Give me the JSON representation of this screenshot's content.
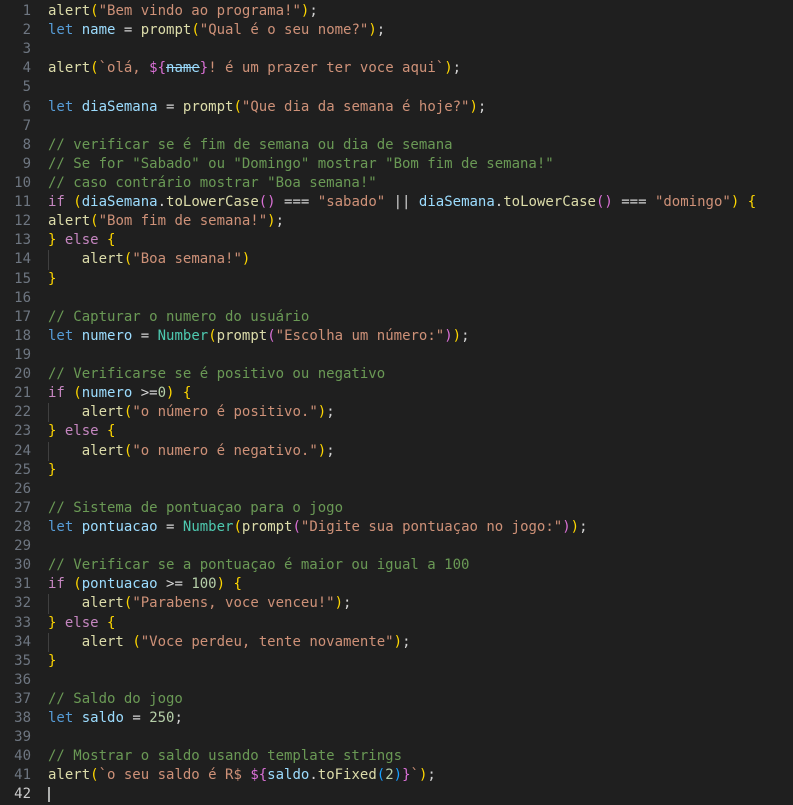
{
  "editor": {
    "background": "#1f1f1f",
    "gutter_color": "#6e7681",
    "active_gutter_color": "#cccccc",
    "indent_guide_color": "#404040",
    "cursor_color": "#aeafad",
    "active_line": 42,
    "palette": {
      "fn": "#DCDCAA",
      "kw": "#569CD6",
      "ctrl": "#C586C0",
      "var": "#9CDCFE",
      "cls": "#4EC9B0",
      "str": "#CE9178",
      "com": "#6A9955",
      "num": "#B5CEA8",
      "op": "#D4D4D4",
      "b1": "#FFD700",
      "b2": "#DA70D6",
      "b3": "#179FFF"
    },
    "lines": [
      {
        "n": 1,
        "tokens": [
          {
            "t": "alert",
            "c": "fn"
          },
          {
            "t": "(",
            "c": "b1"
          },
          {
            "t": "\"Bem vindo ao programa!\"",
            "c": "str"
          },
          {
            "t": ")",
            "c": "b1"
          },
          {
            "t": ";",
            "c": "op"
          }
        ]
      },
      {
        "n": 2,
        "tokens": [
          {
            "t": "let",
            "c": "kw"
          },
          {
            "t": " ",
            "c": "op"
          },
          {
            "t": "name",
            "c": "var"
          },
          {
            "t": " = ",
            "c": "op"
          },
          {
            "t": "prompt",
            "c": "fn"
          },
          {
            "t": "(",
            "c": "b1"
          },
          {
            "t": "\"Qual é o seu nome?\"",
            "c": "str"
          },
          {
            "t": ")",
            "c": "b1"
          },
          {
            "t": ";",
            "c": "op"
          }
        ]
      },
      {
        "n": 3,
        "tokens": []
      },
      {
        "n": 4,
        "tokens": [
          {
            "t": "alert",
            "c": "fn"
          },
          {
            "t": "(",
            "c": "b1"
          },
          {
            "t": "`olá, ",
            "c": "str"
          },
          {
            "t": "${",
            "c": "b2"
          },
          {
            "t": "name",
            "c": "var",
            "s": 1
          },
          {
            "t": "}",
            "c": "b2"
          },
          {
            "t": "! é um prazer ter voce aqui`",
            "c": "str"
          },
          {
            "t": ")",
            "c": "b1"
          },
          {
            "t": ";",
            "c": "op"
          }
        ]
      },
      {
        "n": 5,
        "tokens": []
      },
      {
        "n": 6,
        "tokens": [
          {
            "t": "let",
            "c": "kw"
          },
          {
            "t": " ",
            "c": "op"
          },
          {
            "t": "diaSemana",
            "c": "var"
          },
          {
            "t": " = ",
            "c": "op"
          },
          {
            "t": "prompt",
            "c": "fn"
          },
          {
            "t": "(",
            "c": "b1"
          },
          {
            "t": "\"Que dia da semana é hoje?\"",
            "c": "str"
          },
          {
            "t": ")",
            "c": "b1"
          },
          {
            "t": ";",
            "c": "op"
          }
        ]
      },
      {
        "n": 7,
        "tokens": []
      },
      {
        "n": 8,
        "tokens": [
          {
            "t": "// verificar se é fim de semana ou dia de semana",
            "c": "com"
          }
        ]
      },
      {
        "n": 9,
        "tokens": [
          {
            "t": "// Se for \"Sabado\" ou \"Domingo\" mostrar \"Bom fim de semana!\"",
            "c": "com"
          }
        ]
      },
      {
        "n": 10,
        "tokens": [
          {
            "t": "// caso contrário mostrar \"Boa semana!\"",
            "c": "com"
          }
        ]
      },
      {
        "n": 11,
        "tokens": [
          {
            "t": "if",
            "c": "ctrl"
          },
          {
            "t": " ",
            "c": "op"
          },
          {
            "t": "(",
            "c": "b1"
          },
          {
            "t": "diaSemana",
            "c": "var"
          },
          {
            "t": ".",
            "c": "op"
          },
          {
            "t": "toLowerCase",
            "c": "fn"
          },
          {
            "t": "()",
            "c": "b2"
          },
          {
            "t": " === ",
            "c": "op"
          },
          {
            "t": "\"sabado\"",
            "c": "str"
          },
          {
            "t": " || ",
            "c": "op"
          },
          {
            "t": "diaSemana",
            "c": "var"
          },
          {
            "t": ".",
            "c": "op"
          },
          {
            "t": "toLowerCase",
            "c": "fn"
          },
          {
            "t": "()",
            "c": "b2"
          },
          {
            "t": " === ",
            "c": "op"
          },
          {
            "t": "\"domingo\"",
            "c": "str"
          },
          {
            "t": ")",
            "c": "b1"
          },
          {
            "t": " ",
            "c": "op"
          },
          {
            "t": "{",
            "c": "b1"
          }
        ]
      },
      {
        "n": 12,
        "tokens": [
          {
            "t": "alert",
            "c": "fn"
          },
          {
            "t": "(",
            "c": "b1"
          },
          {
            "t": "\"Bom fim de semana!\"",
            "c": "str"
          },
          {
            "t": ")",
            "c": "b1"
          },
          {
            "t": ";",
            "c": "op"
          }
        ]
      },
      {
        "n": 13,
        "tokens": [
          {
            "t": "}",
            "c": "b1"
          },
          {
            "t": " ",
            "c": "op"
          },
          {
            "t": "else",
            "c": "ctrl"
          },
          {
            "t": " ",
            "c": "op"
          },
          {
            "t": "{",
            "c": "b1"
          }
        ]
      },
      {
        "n": 14,
        "g": 1,
        "tokens": [
          {
            "t": "    ",
            "c": "op"
          },
          {
            "t": "alert",
            "c": "fn"
          },
          {
            "t": "(",
            "c": "b1"
          },
          {
            "t": "\"Boa semana!\"",
            "c": "str"
          },
          {
            "t": ")",
            "c": "b1"
          }
        ]
      },
      {
        "n": 15,
        "tokens": [
          {
            "t": "}",
            "c": "b1"
          }
        ]
      },
      {
        "n": 16,
        "tokens": []
      },
      {
        "n": 17,
        "tokens": [
          {
            "t": "// Capturar o numero do usuário",
            "c": "com"
          }
        ]
      },
      {
        "n": 18,
        "tokens": [
          {
            "t": "let",
            "c": "kw"
          },
          {
            "t": " ",
            "c": "op"
          },
          {
            "t": "numero",
            "c": "var"
          },
          {
            "t": " = ",
            "c": "op"
          },
          {
            "t": "Number",
            "c": "cls"
          },
          {
            "t": "(",
            "c": "b1"
          },
          {
            "t": "prompt",
            "c": "fn"
          },
          {
            "t": "(",
            "c": "b2"
          },
          {
            "t": "\"Escolha um número:\"",
            "c": "str"
          },
          {
            "t": ")",
            "c": "b2"
          },
          {
            "t": ")",
            "c": "b1"
          },
          {
            "t": ";",
            "c": "op"
          }
        ]
      },
      {
        "n": 19,
        "tokens": []
      },
      {
        "n": 20,
        "tokens": [
          {
            "t": "// Verificarse se é positivo ou negativo",
            "c": "com"
          }
        ]
      },
      {
        "n": 21,
        "tokens": [
          {
            "t": "if",
            "c": "ctrl"
          },
          {
            "t": " ",
            "c": "op"
          },
          {
            "t": "(",
            "c": "b1"
          },
          {
            "t": "numero",
            "c": "var"
          },
          {
            "t": " >=",
            "c": "op"
          },
          {
            "t": "0",
            "c": "num"
          },
          {
            "t": ")",
            "c": "b1"
          },
          {
            "t": " ",
            "c": "op"
          },
          {
            "t": "{",
            "c": "b1"
          }
        ]
      },
      {
        "n": 22,
        "g": 1,
        "tokens": [
          {
            "t": "    ",
            "c": "op"
          },
          {
            "t": "alert",
            "c": "fn"
          },
          {
            "t": "(",
            "c": "b1"
          },
          {
            "t": "\"o número é positivo.\"",
            "c": "str"
          },
          {
            "t": ")",
            "c": "b1"
          },
          {
            "t": ";",
            "c": "op"
          }
        ]
      },
      {
        "n": 23,
        "tokens": [
          {
            "t": "}",
            "c": "b1"
          },
          {
            "t": " ",
            "c": "op"
          },
          {
            "t": "else",
            "c": "ctrl"
          },
          {
            "t": " ",
            "c": "op"
          },
          {
            "t": "{",
            "c": "b1"
          }
        ]
      },
      {
        "n": 24,
        "g": 1,
        "tokens": [
          {
            "t": "    ",
            "c": "op"
          },
          {
            "t": "alert",
            "c": "fn"
          },
          {
            "t": "(",
            "c": "b1"
          },
          {
            "t": "\"o numero é negativo.\"",
            "c": "str"
          },
          {
            "t": ")",
            "c": "b1"
          },
          {
            "t": ";",
            "c": "op"
          }
        ]
      },
      {
        "n": 25,
        "tokens": [
          {
            "t": "}",
            "c": "b1"
          }
        ]
      },
      {
        "n": 26,
        "tokens": []
      },
      {
        "n": 27,
        "tokens": [
          {
            "t": "// Sistema de pontuaçao para o jogo",
            "c": "com"
          }
        ]
      },
      {
        "n": 28,
        "tokens": [
          {
            "t": "let",
            "c": "kw"
          },
          {
            "t": " ",
            "c": "op"
          },
          {
            "t": "pontuacao",
            "c": "var"
          },
          {
            "t": " = ",
            "c": "op"
          },
          {
            "t": "Number",
            "c": "cls"
          },
          {
            "t": "(",
            "c": "b1"
          },
          {
            "t": "prompt",
            "c": "fn"
          },
          {
            "t": "(",
            "c": "b2"
          },
          {
            "t": "\"Digite sua pontuaçao no jogo:\"",
            "c": "str"
          },
          {
            "t": ")",
            "c": "b2"
          },
          {
            "t": ")",
            "c": "b1"
          },
          {
            "t": ";",
            "c": "op"
          }
        ]
      },
      {
        "n": 29,
        "tokens": []
      },
      {
        "n": 30,
        "tokens": [
          {
            "t": "// Verificar se a pontuaçao é maior ou igual a 100",
            "c": "com"
          }
        ]
      },
      {
        "n": 31,
        "tokens": [
          {
            "t": "if",
            "c": "ctrl"
          },
          {
            "t": " ",
            "c": "op"
          },
          {
            "t": "(",
            "c": "b1"
          },
          {
            "t": "pontuacao",
            "c": "var"
          },
          {
            "t": " >= ",
            "c": "op"
          },
          {
            "t": "100",
            "c": "num"
          },
          {
            "t": ")",
            "c": "b1"
          },
          {
            "t": " ",
            "c": "op"
          },
          {
            "t": "{",
            "c": "b1"
          }
        ]
      },
      {
        "n": 32,
        "g": 1,
        "tokens": [
          {
            "t": "    ",
            "c": "op"
          },
          {
            "t": "alert",
            "c": "fn"
          },
          {
            "t": "(",
            "c": "b1"
          },
          {
            "t": "\"Parabens, voce venceu!\"",
            "c": "str"
          },
          {
            "t": ")",
            "c": "b1"
          },
          {
            "t": ";",
            "c": "op"
          }
        ]
      },
      {
        "n": 33,
        "tokens": [
          {
            "t": "}",
            "c": "b1"
          },
          {
            "t": " ",
            "c": "op"
          },
          {
            "t": "else",
            "c": "ctrl"
          },
          {
            "t": " ",
            "c": "op"
          },
          {
            "t": "{",
            "c": "b1"
          }
        ]
      },
      {
        "n": 34,
        "g": 1,
        "tokens": [
          {
            "t": "    ",
            "c": "op"
          },
          {
            "t": "alert",
            "c": "fn"
          },
          {
            "t": " ",
            "c": "op"
          },
          {
            "t": "(",
            "c": "b1"
          },
          {
            "t": "\"Voce perdeu, tente novamente\"",
            "c": "str"
          },
          {
            "t": ")",
            "c": "b1"
          },
          {
            "t": ";",
            "c": "op"
          }
        ]
      },
      {
        "n": 35,
        "tokens": [
          {
            "t": "}",
            "c": "b1"
          }
        ]
      },
      {
        "n": 36,
        "tokens": []
      },
      {
        "n": 37,
        "tokens": [
          {
            "t": "// Saldo do jogo",
            "c": "com"
          }
        ]
      },
      {
        "n": 38,
        "tokens": [
          {
            "t": "let",
            "c": "kw"
          },
          {
            "t": " ",
            "c": "op"
          },
          {
            "t": "saldo",
            "c": "var"
          },
          {
            "t": " = ",
            "c": "op"
          },
          {
            "t": "250",
            "c": "num"
          },
          {
            "t": ";",
            "c": "op"
          }
        ]
      },
      {
        "n": 39,
        "tokens": []
      },
      {
        "n": 40,
        "tokens": [
          {
            "t": "// Mostrar o saldo usando template strings",
            "c": "com"
          }
        ]
      },
      {
        "n": 41,
        "tokens": [
          {
            "t": "alert",
            "c": "fn"
          },
          {
            "t": "(",
            "c": "b1"
          },
          {
            "t": "`o seu saldo é R$ ",
            "c": "str"
          },
          {
            "t": "${",
            "c": "b2"
          },
          {
            "t": "saldo",
            "c": "var"
          },
          {
            "t": ".",
            "c": "op"
          },
          {
            "t": "toFixed",
            "c": "fn"
          },
          {
            "t": "(",
            "c": "b3"
          },
          {
            "t": "2",
            "c": "num"
          },
          {
            "t": ")",
            "c": "b3"
          },
          {
            "t": "}",
            "c": "b2"
          },
          {
            "t": "`",
            "c": "str"
          },
          {
            "t": ")",
            "c": "b1"
          },
          {
            "t": ";",
            "c": "op"
          }
        ]
      },
      {
        "n": 42,
        "cursor": 1,
        "tokens": []
      }
    ]
  }
}
